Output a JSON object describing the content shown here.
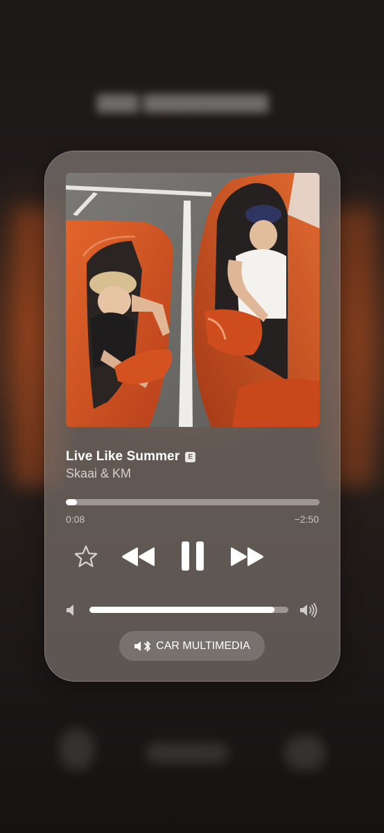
{
  "player": {
    "song_title": "Live Like Summer",
    "explicit_badge": "E",
    "artist": "Skaai & KM",
    "progress_fraction": 0.043,
    "time_elapsed": "0:08",
    "time_remaining": "−2:50",
    "volume_fraction": 0.93,
    "output_device": "CAR MULTIMEDIA"
  },
  "icons": {
    "favorite": "star-outline-icon",
    "previous": "rewind-icon",
    "play_pause": "pause-icon",
    "next": "fast-forward-icon",
    "volume_low": "speaker-low-icon",
    "volume_high": "speaker-high-icon",
    "output": "speaker-bluetooth-icon"
  },
  "colors": {
    "card_tint": "#78706c",
    "text_primary": "#ffffff",
    "car_orange": "#d9521f"
  }
}
